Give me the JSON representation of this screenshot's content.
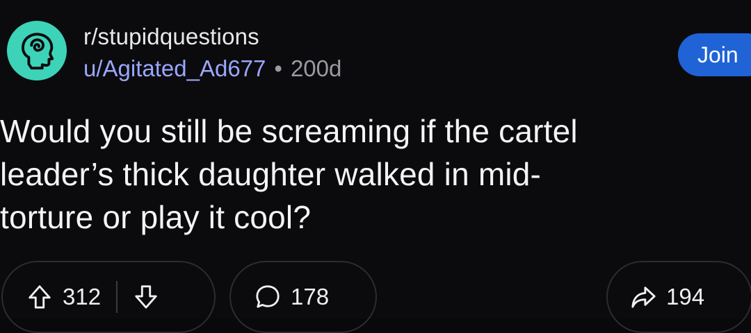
{
  "post": {
    "subreddit": "r/stupidquestions",
    "username": "u/Agitated_Ad677",
    "separator": "•",
    "age": "200d",
    "join_label": "Join",
    "title": "Would you still be screaming if the cartel\nleader’s thick daughter walked in mid-\ntorture or play it cool?"
  },
  "actions": {
    "upvotes": "312",
    "comments": "178",
    "shares": "194"
  },
  "icons": {
    "avatar": "subreddit-avatar-icon",
    "upvote": "arrow-up-icon",
    "downvote": "arrow-down-icon",
    "comment": "speech-bubble-icon",
    "share": "share-arrow-icon"
  },
  "colors": {
    "background": "#0b0b0d",
    "avatar": "#3dd3b8",
    "join_button": "#1f63d6",
    "username": "#9aa6ff"
  }
}
